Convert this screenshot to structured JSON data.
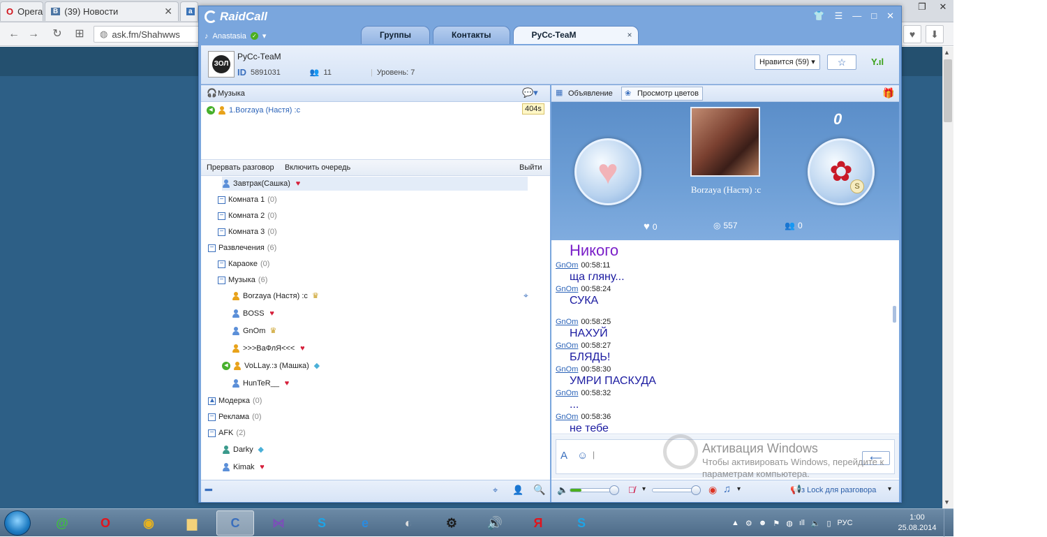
{
  "browser": {
    "opera_label": "Opera",
    "tabs": [
      {
        "icon": "vk-icon",
        "label": "(39) Новости"
      },
      {
        "icon": "ask-icon",
        "label": ""
      }
    ],
    "address": "ask.fm/Shahwws"
  },
  "raidcall": {
    "app_name": "RaidCall",
    "user": "Anastasia",
    "tabs": [
      {
        "label": "Группы"
      },
      {
        "label": "Контакты"
      },
      {
        "label": "РуСс-ТеаМ",
        "active": true
      }
    ],
    "channel": {
      "name": "РуСс-ТеаМ",
      "id_label": "ID",
      "id": "5891031",
      "members": "11",
      "level": "Уровень: 7",
      "like_button": "Нравится (59)",
      "avatar_text": "ЗОЛ"
    },
    "left": {
      "music_label": "Музыка",
      "queue": [
        {
          "text": "1.Borzaya (Настя) :c",
          "time": "404s"
        }
      ],
      "actions": {
        "break": "Прервать разговор",
        "queue": "Включить очередь",
        "exit": "Выйти"
      },
      "tree": [
        {
          "type": "user",
          "indent": 1,
          "name": "Завтрак(Сашка)",
          "badge": "heart",
          "selected": true
        },
        {
          "type": "group",
          "indent": 1,
          "name": "Комната 1",
          "count": "(0)"
        },
        {
          "type": "group",
          "indent": 1,
          "name": "Комната 2",
          "count": "(0)"
        },
        {
          "type": "group",
          "indent": 1,
          "name": "Комната 3",
          "count": "(0)"
        },
        {
          "type": "group",
          "indent": 0,
          "name": "Развлечения",
          "count": "(6)"
        },
        {
          "type": "group",
          "indent": 1,
          "name": "Караоке",
          "count": "(0)"
        },
        {
          "type": "group",
          "indent": 1,
          "name": "Музыка",
          "count": "(6)"
        },
        {
          "type": "user",
          "indent": 2,
          "name": "Borzaya (Настя) :c",
          "badge": "crown",
          "color": "#e8a21a",
          "pin": true
        },
        {
          "type": "user",
          "indent": 2,
          "name": "BOSS",
          "badge": "heart"
        },
        {
          "type": "user",
          "indent": 2,
          "name": "GnOm",
          "badge": "crown-silver"
        },
        {
          "type": "user",
          "indent": 2,
          "name": ">>>ВаФлЯ<<<",
          "badge": "heart",
          "color": "#e8a21a"
        },
        {
          "type": "user",
          "indent": 1,
          "name": "VoLLay.:з (Машка)",
          "badge": "diamond",
          "color": "#e8a21a",
          "speaking": true
        },
        {
          "type": "user",
          "indent": 2,
          "name": "HunTeR__",
          "badge": "heart"
        },
        {
          "type": "group-lock",
          "indent": 0,
          "name": "Модерка",
          "count": "(0)"
        },
        {
          "type": "group",
          "indent": 0,
          "name": "Реклама",
          "count": "(0)"
        },
        {
          "type": "group",
          "indent": 0,
          "name": "AFK",
          "count": "(2)"
        },
        {
          "type": "user",
          "indent": 1,
          "name": "Darky",
          "badge": "diamond",
          "color": "#3a9a8c"
        },
        {
          "type": "user",
          "indent": 1,
          "name": "Kimak",
          "badge": "heart"
        }
      ]
    },
    "right": {
      "announcement": "Объявление",
      "view_flowers": "Просмотр цветов",
      "performer": "Borzaya (Настя) :c",
      "gift_count": "0",
      "stats": {
        "hearts": "0",
        "listeners": "557",
        "groups": "0"
      },
      "chat": {
        "lead": "Никого",
        "messages": [
          {
            "nick": "GnOm",
            "time": "00:58:11",
            "text": "ща гляну..."
          },
          {
            "nick": "GnOm",
            "time": "00:58:24",
            "text": "СУКА"
          },
          {
            "nick": "GnOm",
            "time": "00:58:25",
            "text": "НАХУЙ"
          },
          {
            "nick": "GnOm",
            "time": "00:58:27",
            "text": "БЛЯДЬ!"
          },
          {
            "nick": "GnOm",
            "time": "00:58:30",
            "text": "УМРИ ПАСКУДА"
          },
          {
            "nick": "GnOm",
            "time": "00:58:32",
            "text": "..."
          },
          {
            "nick": "GnOm",
            "time": "00:58:36",
            "text": "не тебе"
          }
        ]
      },
      "voice_mode": "з Lock для разговора"
    }
  },
  "activation": {
    "title": "Активация Windows",
    "subtitle": "Чтобы активировать Windows, перейдите к параметрам компьютера."
  },
  "taskbar": {
    "lang": "РУС",
    "time": "1:00",
    "date": "25.08.2014"
  },
  "colors": {
    "accent": "#3a6fbd",
    "window": "#7aa6dd",
    "chat_text": "#1a1aa0"
  }
}
